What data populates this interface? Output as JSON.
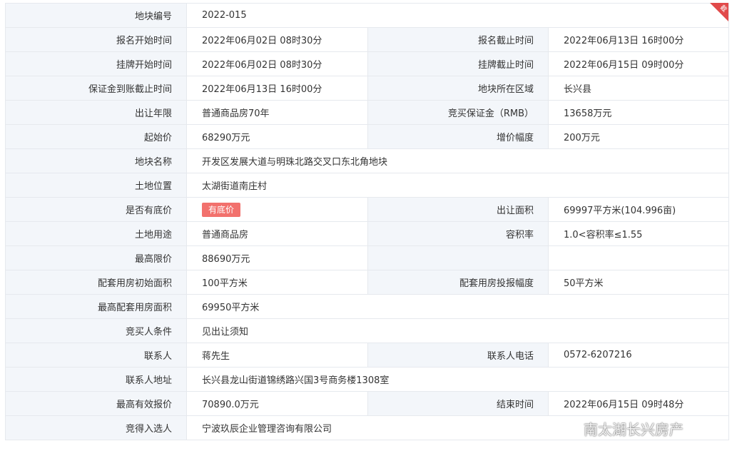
{
  "rows": [
    {
      "l1": "地块编号",
      "v1": "2022-015"
    },
    {
      "l1": "报名开始时间",
      "v1": "2022年06月02日 08时30分",
      "l2": "报名截止时间",
      "v2": "2022年06月13日 16时00分"
    },
    {
      "l1": "挂牌开始时间",
      "v1": "2022年06月02日 08时30分",
      "l2": "挂牌截止时间",
      "v2": "2022年06月15日 09时00分"
    },
    {
      "l1": "保证金到账截止时间",
      "v1": "2022年06月13日 16时00分",
      "l2": "地块所在区域",
      "v2": "长兴县"
    },
    {
      "l1": "出让年限",
      "v1": "普通商品房70年",
      "l2": "竞买保证金（RMB）",
      "v2": "13658万元"
    },
    {
      "l1": "起始价",
      "v1": "68290万元",
      "l2": "增价幅度",
      "v2": "200万元"
    },
    {
      "l1": "地块名称",
      "v1": "开发区发展大道与明珠北路交叉口东北角地块"
    },
    {
      "l1": "土地位置",
      "v1": "太湖街道南庄村"
    },
    {
      "l1": "是否有底价",
      "badge": "有底价",
      "l2": "出让面积",
      "v2": "69997平方米(104.996亩)"
    },
    {
      "l1": "土地用途",
      "v1": "普通商品房",
      "l2": "容积率",
      "v2": "1.0<容积率≤1.55"
    },
    {
      "l1": "最高限价",
      "v1": "88690万元",
      "l2": "",
      "v2": ""
    },
    {
      "l1": "配套用房初始面积",
      "v1": "100平方米",
      "l2": "配套用房投报幅度",
      "v2": "50平方米"
    },
    {
      "l1": "最高配套用房面积",
      "v1": "69950平方米"
    },
    {
      "l1": "竞买人条件",
      "v1": "见出让须知"
    },
    {
      "l1": "联系人",
      "v1": "蒋先生",
      "l2": "联系人电话",
      "v2": "0572-6207216"
    },
    {
      "l1": "联系人地址",
      "v1": "长兴县龙山街道锦绣路兴国3号商务楼1308室"
    },
    {
      "l1": "最高有效报价",
      "v1": "70890.0万元",
      "l2": "结束时间",
      "v2": "2022年06月15日 09时48分"
    },
    {
      "l1": "竞得入选人",
      "v1": "宁波玖辰企业管理咨询有限公司"
    }
  ],
  "corner_tag": "截",
  "watermark": "南太湖长兴房产",
  "colors": {
    "label_bg": "#f3f6fa",
    "border": "#e6e9ee",
    "badge": "#f2716d"
  }
}
